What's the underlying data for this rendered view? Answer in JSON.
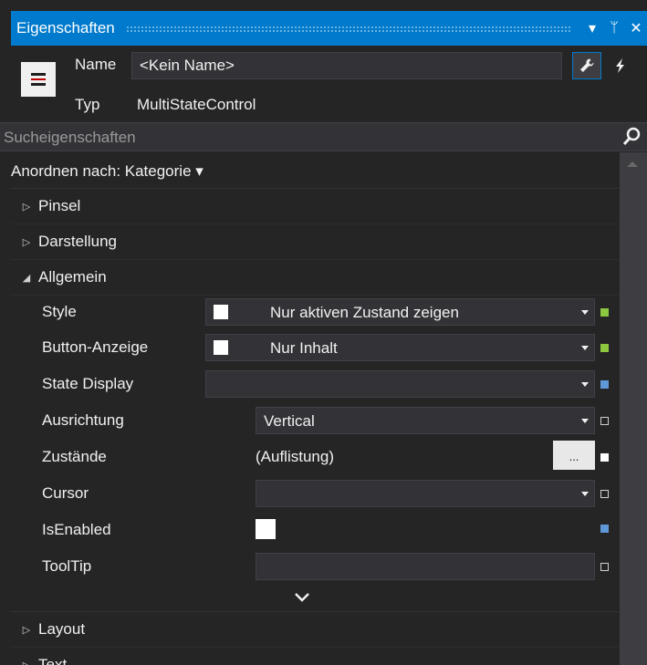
{
  "window": {
    "title": "Eigenschaften",
    "buttons": [
      "▾",
      "ᛘ",
      "✕"
    ]
  },
  "header": {
    "name_label": "Name",
    "name_value": "<Kein Name>",
    "type_label": "Typ",
    "type_value": "MultiStateControl"
  },
  "search": {
    "placeholder": "Sucheigenschaften"
  },
  "arrange": {
    "label": "Anordnen nach: Kategorie ▾"
  },
  "categories": [
    {
      "label": "Pinsel",
      "expanded": false
    },
    {
      "label": "Darstellung",
      "expanded": false
    },
    {
      "label": "Allgemein",
      "expanded": true
    },
    {
      "label": "Layout",
      "expanded": false
    },
    {
      "label": "Text",
      "expanded": false
    }
  ],
  "properties": [
    {
      "label": "Style",
      "value": "Nur aktiven Zustand zeigen",
      "marker": "green"
    },
    {
      "label": "Button-Anzeige",
      "value": "Nur Inhalt",
      "marker": "green"
    },
    {
      "label": "State Display",
      "value": "",
      "marker": "blue"
    },
    {
      "label": "Ausrichtung",
      "value": "Vertical",
      "marker": "empty"
    },
    {
      "label": "Zustände",
      "value": "(Auflistung)",
      "button": "...",
      "marker": "white"
    },
    {
      "label": "Cursor",
      "value": "",
      "marker": "empty"
    },
    {
      "label": "IsEnabled",
      "checked": false,
      "marker": "blue"
    },
    {
      "label": "ToolTip",
      "value": "",
      "marker": "empty"
    }
  ],
  "colors": {
    "accent": "#007acc",
    "panel_bg": "#252526",
    "field_bg": "#333337",
    "marker_green": "#8dc63f",
    "marker_blue": "#5e98d8"
  },
  "icons": {
    "control": "multistate-control-icon",
    "properties_view": "wrench-icon",
    "events_view": "lightning-icon",
    "search": "search-icon",
    "collapse": "chevron-down-icon"
  }
}
